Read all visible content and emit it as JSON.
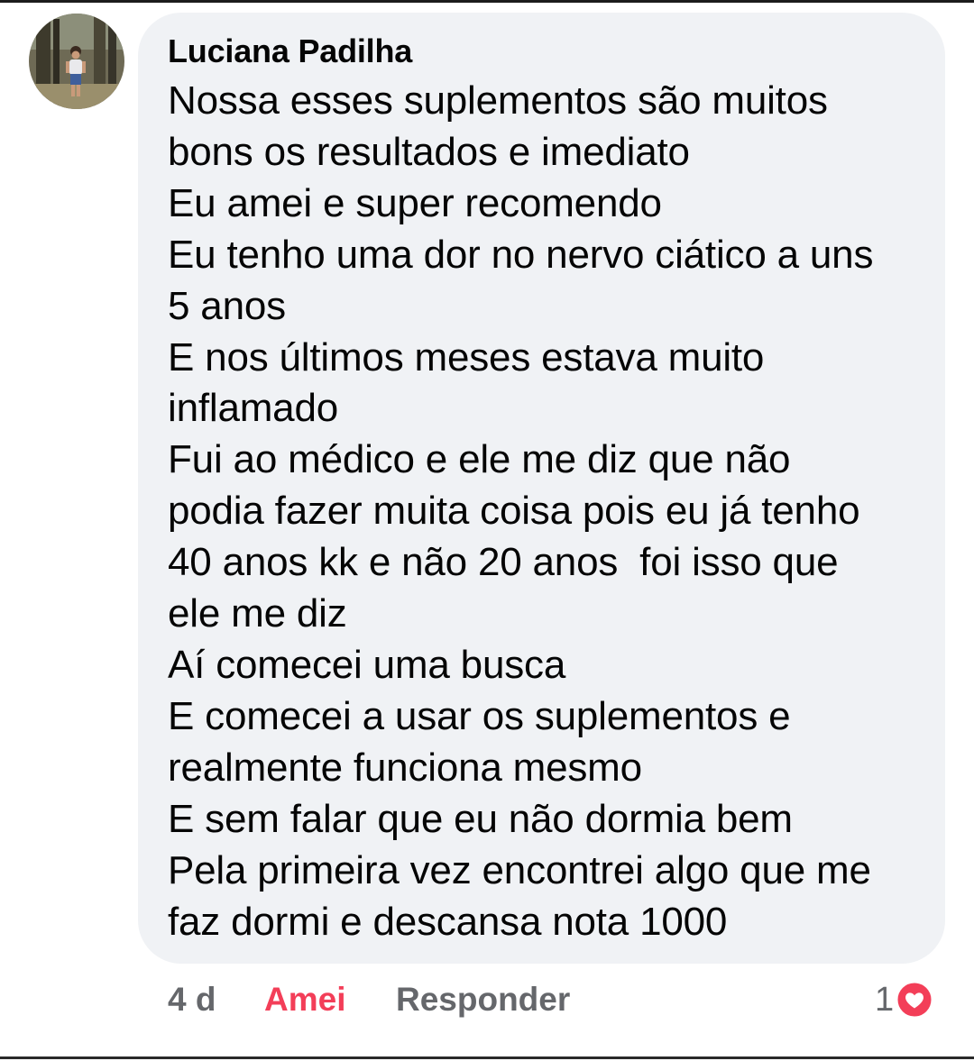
{
  "comment": {
    "author": "Luciana Padilha",
    "lines": [
      "Nossa esses suplementos são muitos",
      "bons os resultados e imediato",
      "Eu amei e super recomendo",
      "Eu tenho uma dor no nervo ciático a uns",
      "5 anos",
      "E nos últimos meses estava muito",
      "inflamado",
      "Fui ao médico e ele me diz que não",
      "podia fazer muita coisa pois eu já tenho",
      "40 anos kk e não 20 anos  foi isso que",
      "ele me diz",
      "Aí comecei uma busca",
      "E comecei a usar os suplementos e",
      "realmente funciona mesmo",
      "E sem falar que eu não dormia bem",
      "Pela primeira vez encontrei algo que me",
      "faz dormi e descansa nota 1000"
    ]
  },
  "actions": {
    "time": "4 d",
    "reaction_label": "Amei",
    "reply_label": "Responder"
  },
  "reactions": {
    "count": "1",
    "icon": "heart-icon"
  },
  "colors": {
    "bubble": "#f0f2f5",
    "text": "#050505",
    "secondary": "#65676b",
    "love": "#f33e58"
  }
}
